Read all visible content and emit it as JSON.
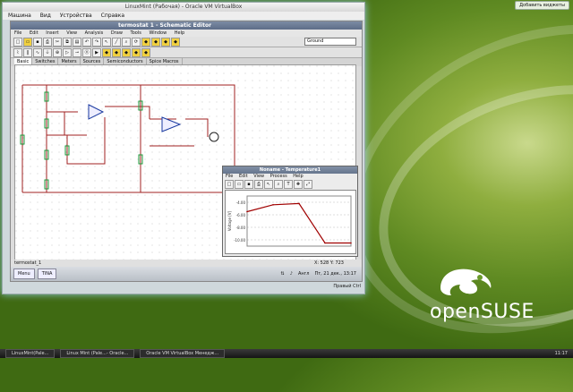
{
  "desktop": {
    "top_button": "Добавить виджеты",
    "brand": "openSUSE",
    "taskbar_items": [
      "LinuxMint(Pale...",
      "Linux Mint (Pale...- Oracle...",
      "Oracle VM VirtualBox Менедж..."
    ],
    "tray_time": "11:17"
  },
  "vbox": {
    "title": "LinuxMint (Рабочая) - Oracle VM VirtualBox",
    "menu": [
      "Машина",
      "Вид",
      "Устройства",
      "Справка"
    ],
    "host_key": "Правый Ctrl"
  },
  "editor": {
    "title": "termostat 1 - Schematic Editor",
    "menu": [
      "File",
      "Edit",
      "Insert",
      "View",
      "Analysis",
      "Draw",
      "Tools",
      "Window",
      "Help"
    ],
    "combo_value": "Ground",
    "tabs": [
      "Basic",
      "Switches",
      "Meters",
      "Sources",
      "Semiconductors",
      "Spice Macros"
    ],
    "sheet_tab": "termostat_1",
    "coords": "X: 528  Y: 723"
  },
  "guest_taskbar": {
    "menu_label": "Menu",
    "app_label": "TINA",
    "lang": "Англ",
    "datetime": "Пт, 21 дек., 13:17"
  },
  "temperature_window": {
    "title": "Noname - Temperature1",
    "menu": [
      "File",
      "Edit",
      "View",
      "Process",
      "Help"
    ],
    "ylabel": "Voltage [V]",
    "y_ticks": [
      "-4.00",
      "-6.00",
      "-8.00",
      "-10.00"
    ]
  },
  "chart_data": {
    "type": "line",
    "x": [
      0,
      1,
      2,
      3,
      4
    ],
    "y": [
      -5.5,
      -4.4,
      -4.2,
      -10.5,
      -10.5
    ],
    "ylabel": "Voltage [V]",
    "ylim": [
      -11,
      -3
    ],
    "grid": true
  },
  "colors": {
    "accent": "#5f8a22",
    "wire": "#a02020",
    "trace": "#a00000"
  }
}
